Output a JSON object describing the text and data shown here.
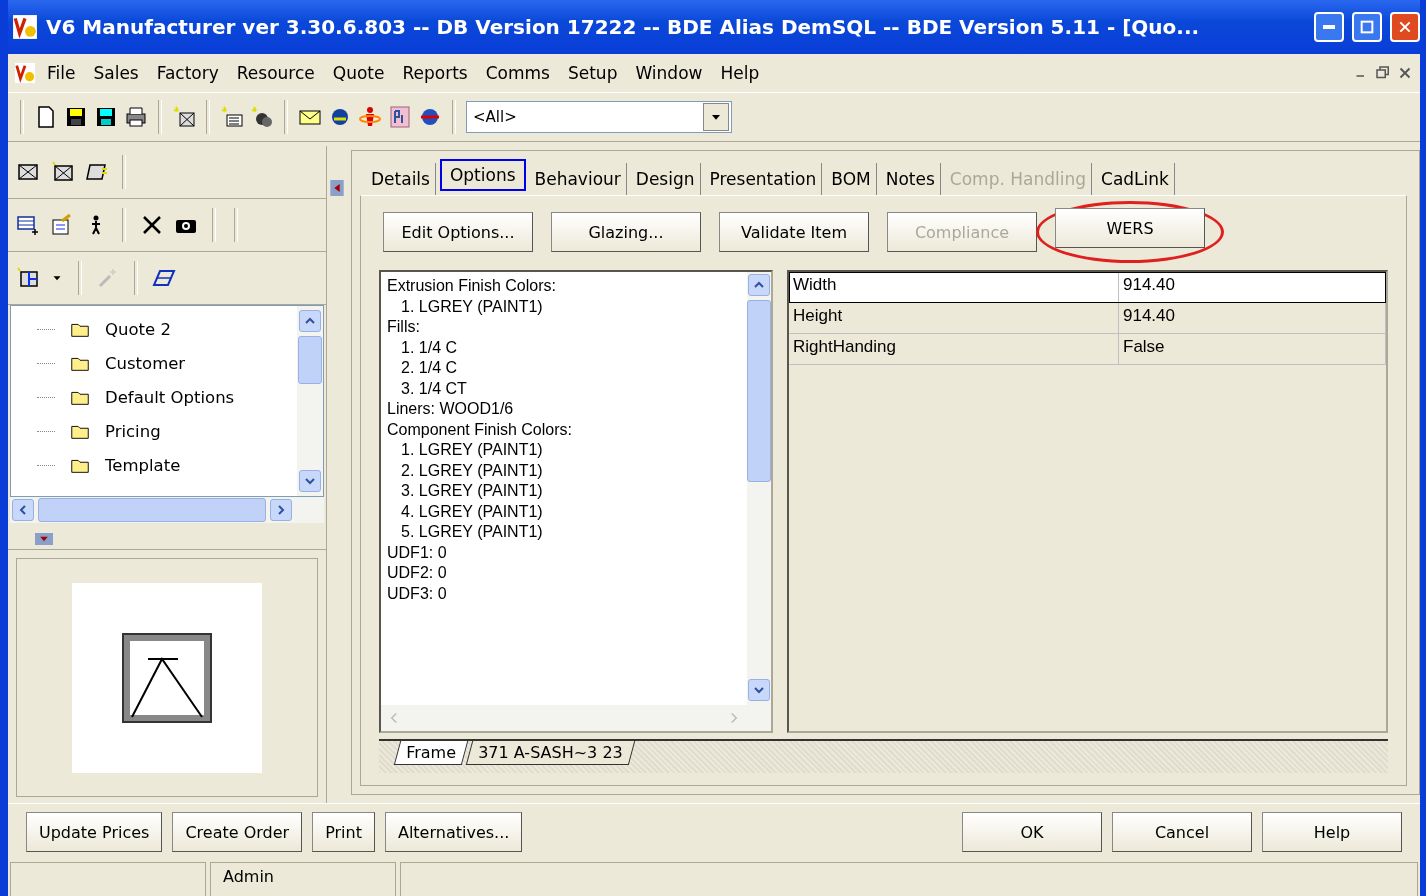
{
  "window": {
    "title": "V6 Manufacturer ver 3.30.6.803 -- DB Version 17222 -- BDE Alias DemSQL -- BDE Version 5.11 - [Quo..."
  },
  "menu": {
    "items": [
      "File",
      "Sales",
      "Factory",
      "Resource",
      "Quote",
      "Reports",
      "Comms",
      "Setup",
      "Window",
      "Help"
    ]
  },
  "toolbar": {
    "filter_combo": {
      "value": "<All>"
    }
  },
  "tree": {
    "items": [
      {
        "label": "Quote 2"
      },
      {
        "label": "Customer"
      },
      {
        "label": "Default Options"
      },
      {
        "label": "Pricing"
      },
      {
        "label": "Template"
      }
    ]
  },
  "tabs": [
    {
      "label": "Details",
      "selected": false,
      "disabled": false
    },
    {
      "label": "Options",
      "selected": true,
      "disabled": false
    },
    {
      "label": "Behaviour",
      "selected": false,
      "disabled": false
    },
    {
      "label": "Design",
      "selected": false,
      "disabled": false
    },
    {
      "label": "Presentation",
      "selected": false,
      "disabled": false
    },
    {
      "label": "BOM",
      "selected": false,
      "disabled": false
    },
    {
      "label": "Notes",
      "selected": false,
      "disabled": false
    },
    {
      "label": "Comp. Handling",
      "selected": false,
      "disabled": true
    },
    {
      "label": "CadLink",
      "selected": false,
      "disabled": false
    }
  ],
  "actions": [
    {
      "label": "Edit Options...",
      "disabled": false,
      "circled": false
    },
    {
      "label": "Glazing...",
      "disabled": false,
      "circled": false
    },
    {
      "label": "Validate Item",
      "disabled": false,
      "circled": false
    },
    {
      "label": "Compliance",
      "disabled": true,
      "circled": false
    },
    {
      "label": "WERS",
      "disabled": false,
      "circled": true
    }
  ],
  "options_list": [
    {
      "text": "Extrusion Finish Colors:",
      "children": [
        {
          "text": "1. LGREY (PAINT1)"
        }
      ]
    },
    {
      "text": "Fills:",
      "children": [
        {
          "text": "1. 1/4 C"
        },
        {
          "text": "2. 1/4 C"
        },
        {
          "text": "3. 1/4 CT"
        }
      ]
    },
    {
      "text": "Liners: WOOD1/6"
    },
    {
      "text": "Component Finish Colors:",
      "children": [
        {
          "text": "1. LGREY (PAINT1)"
        },
        {
          "text": "2. LGREY (PAINT1)"
        },
        {
          "text": "3. LGREY (PAINT1)"
        },
        {
          "text": "4. LGREY (PAINT1)"
        },
        {
          "text": "5. LGREY (PAINT1)"
        }
      ]
    },
    {
      "text": "UDF1: 0"
    },
    {
      "text": "UDF2: 0"
    },
    {
      "text": "UDF3: 0"
    }
  ],
  "properties": [
    {
      "name": "Width",
      "value": "914.40",
      "selected": true
    },
    {
      "name": "Height",
      "value": "914.40",
      "selected": false
    },
    {
      "name": "RightHanding",
      "value": "False",
      "selected": false
    }
  ],
  "sheet_tabs": [
    {
      "label": "Frame",
      "selected": true
    },
    {
      "label": "371 A-SASH~3 23",
      "selected": false
    }
  ],
  "bottom_buttons": {
    "left": [
      "Update Prices",
      "Create Order",
      "Print",
      "Alternatives..."
    ],
    "right": [
      "OK",
      "Cancel",
      "Help"
    ]
  },
  "status_bar": [
    "Admin"
  ]
}
